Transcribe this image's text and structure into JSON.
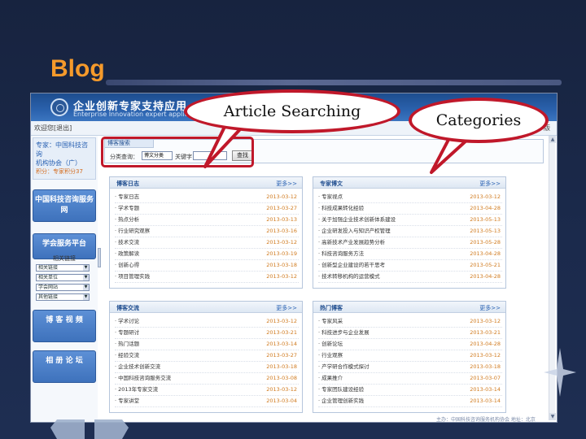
{
  "slide": {
    "title": "Blog"
  },
  "app": {
    "brand_cn": "企业创新专家支持应用",
    "brand_en": "Enterprise Innovation expert application"
  },
  "topbar": {
    "left": "欢迎您[退出]",
    "right": "版"
  },
  "sidebar": {
    "user_title": "专家：中国科技咨询",
    "user_line2": "机构协会（广）",
    "user_sub": "积分：专家积分37",
    "buttons": [
      "中国科技咨询服务网",
      "学会服务平台"
    ],
    "sub_head": "相关链接",
    "selects": [
      "相关链接",
      "相关单位",
      "学会网站",
      "其他链接"
    ],
    "buttons_bottom": [
      "博 客 视 频",
      "相 册 论 坛"
    ]
  },
  "search": {
    "tab": "博客搜索",
    "category_label": "分类查询：",
    "category_value": "博文分类",
    "keyword_label": "关键字：",
    "keyword_value": "",
    "button": "查找"
  },
  "panels": [
    {
      "title": "博客日志",
      "more": "更多>>",
      "rows": [
        {
          "text": "· 专家日志",
          "date": "2013-03-12"
        },
        {
          "text": "· 学术专题",
          "date": "2013-03-27"
        },
        {
          "text": "· 热点分析",
          "date": "2013-03-13"
        },
        {
          "text": "· 行业研究观察",
          "date": "2013-03-16"
        },
        {
          "text": "· 技术交流",
          "date": "2013-03-12"
        },
        {
          "text": "· 政策解读",
          "date": "2013-03-19"
        },
        {
          "text": "· 创新心得",
          "date": "2013-03-18"
        },
        {
          "text": "· 项目管理实践",
          "date": "2013-03-12"
        }
      ]
    },
    {
      "title": "专家博文",
      "more": "更多>>",
      "rows": [
        {
          "text": "· 专家视点",
          "date": "2013-03-12"
        },
        {
          "text": "· 科技成果转化经验",
          "date": "2013-04-28"
        },
        {
          "text": "· 关于加强企业技术创新体系建设",
          "date": "2013-05-13"
        },
        {
          "text": "· 企业研发投入与知识产权管理",
          "date": "2013-05-13"
        },
        {
          "text": "· 高新技术产业发展趋势分析",
          "date": "2013-05-28"
        },
        {
          "text": "· 科技咨询服务方法",
          "date": "2013-04-28"
        },
        {
          "text": "· 创新型企业建设的若干思考",
          "date": "2013-05-21"
        },
        {
          "text": "· 技术转移机构的运营模式",
          "date": "2013-04-28"
        }
      ]
    },
    {
      "title": "博客交流",
      "more": "更多>>",
      "rows": [
        {
          "text": "· 学术讨论",
          "date": "2013-03-12"
        },
        {
          "text": "· 专题研讨",
          "date": "2013-03-21"
        },
        {
          "text": "· 热门话题",
          "date": "2013-03-14"
        },
        {
          "text": "· 经验交流",
          "date": "2013-03-27"
        },
        {
          "text": "· 企业技术创新交流",
          "date": "2013-03-18"
        },
        {
          "text": "· 中国科技咨询服务交流",
          "date": "2013-03-08"
        },
        {
          "text": "· 2013年专家交流",
          "date": "2013-03-12"
        },
        {
          "text": "· 专家讲堂",
          "date": "2013-03-04"
        }
      ]
    },
    {
      "title": "热门博客",
      "more": "更多>>",
      "rows": [
        {
          "text": "· 专家风采",
          "date": "2013-03-12"
        },
        {
          "text": "· 科技进步与企业发展",
          "date": "2013-03-21"
        },
        {
          "text": "· 创新论坛",
          "date": "2013-04-28"
        },
        {
          "text": "· 行业观察",
          "date": "2013-03-12"
        },
        {
          "text": "· 产学研合作模式探讨",
          "date": "2013-03-18"
        },
        {
          "text": "· 成果推介",
          "date": "2013-03-07"
        },
        {
          "text": "· 专家团队建设经验",
          "date": "2013-03-14"
        },
        {
          "text": "· 企业管理创新实践",
          "date": "2013-03-14"
        }
      ]
    }
  ],
  "callouts": {
    "search": "Article Searching",
    "categories": "Categories"
  },
  "footer": "主办：中国科技咨询服务机构协会 地址：北京",
  "colors": {
    "callout_border": "#c0182a",
    "title_orange": "#f59a2b",
    "banner_blue": "#2b62ad"
  }
}
